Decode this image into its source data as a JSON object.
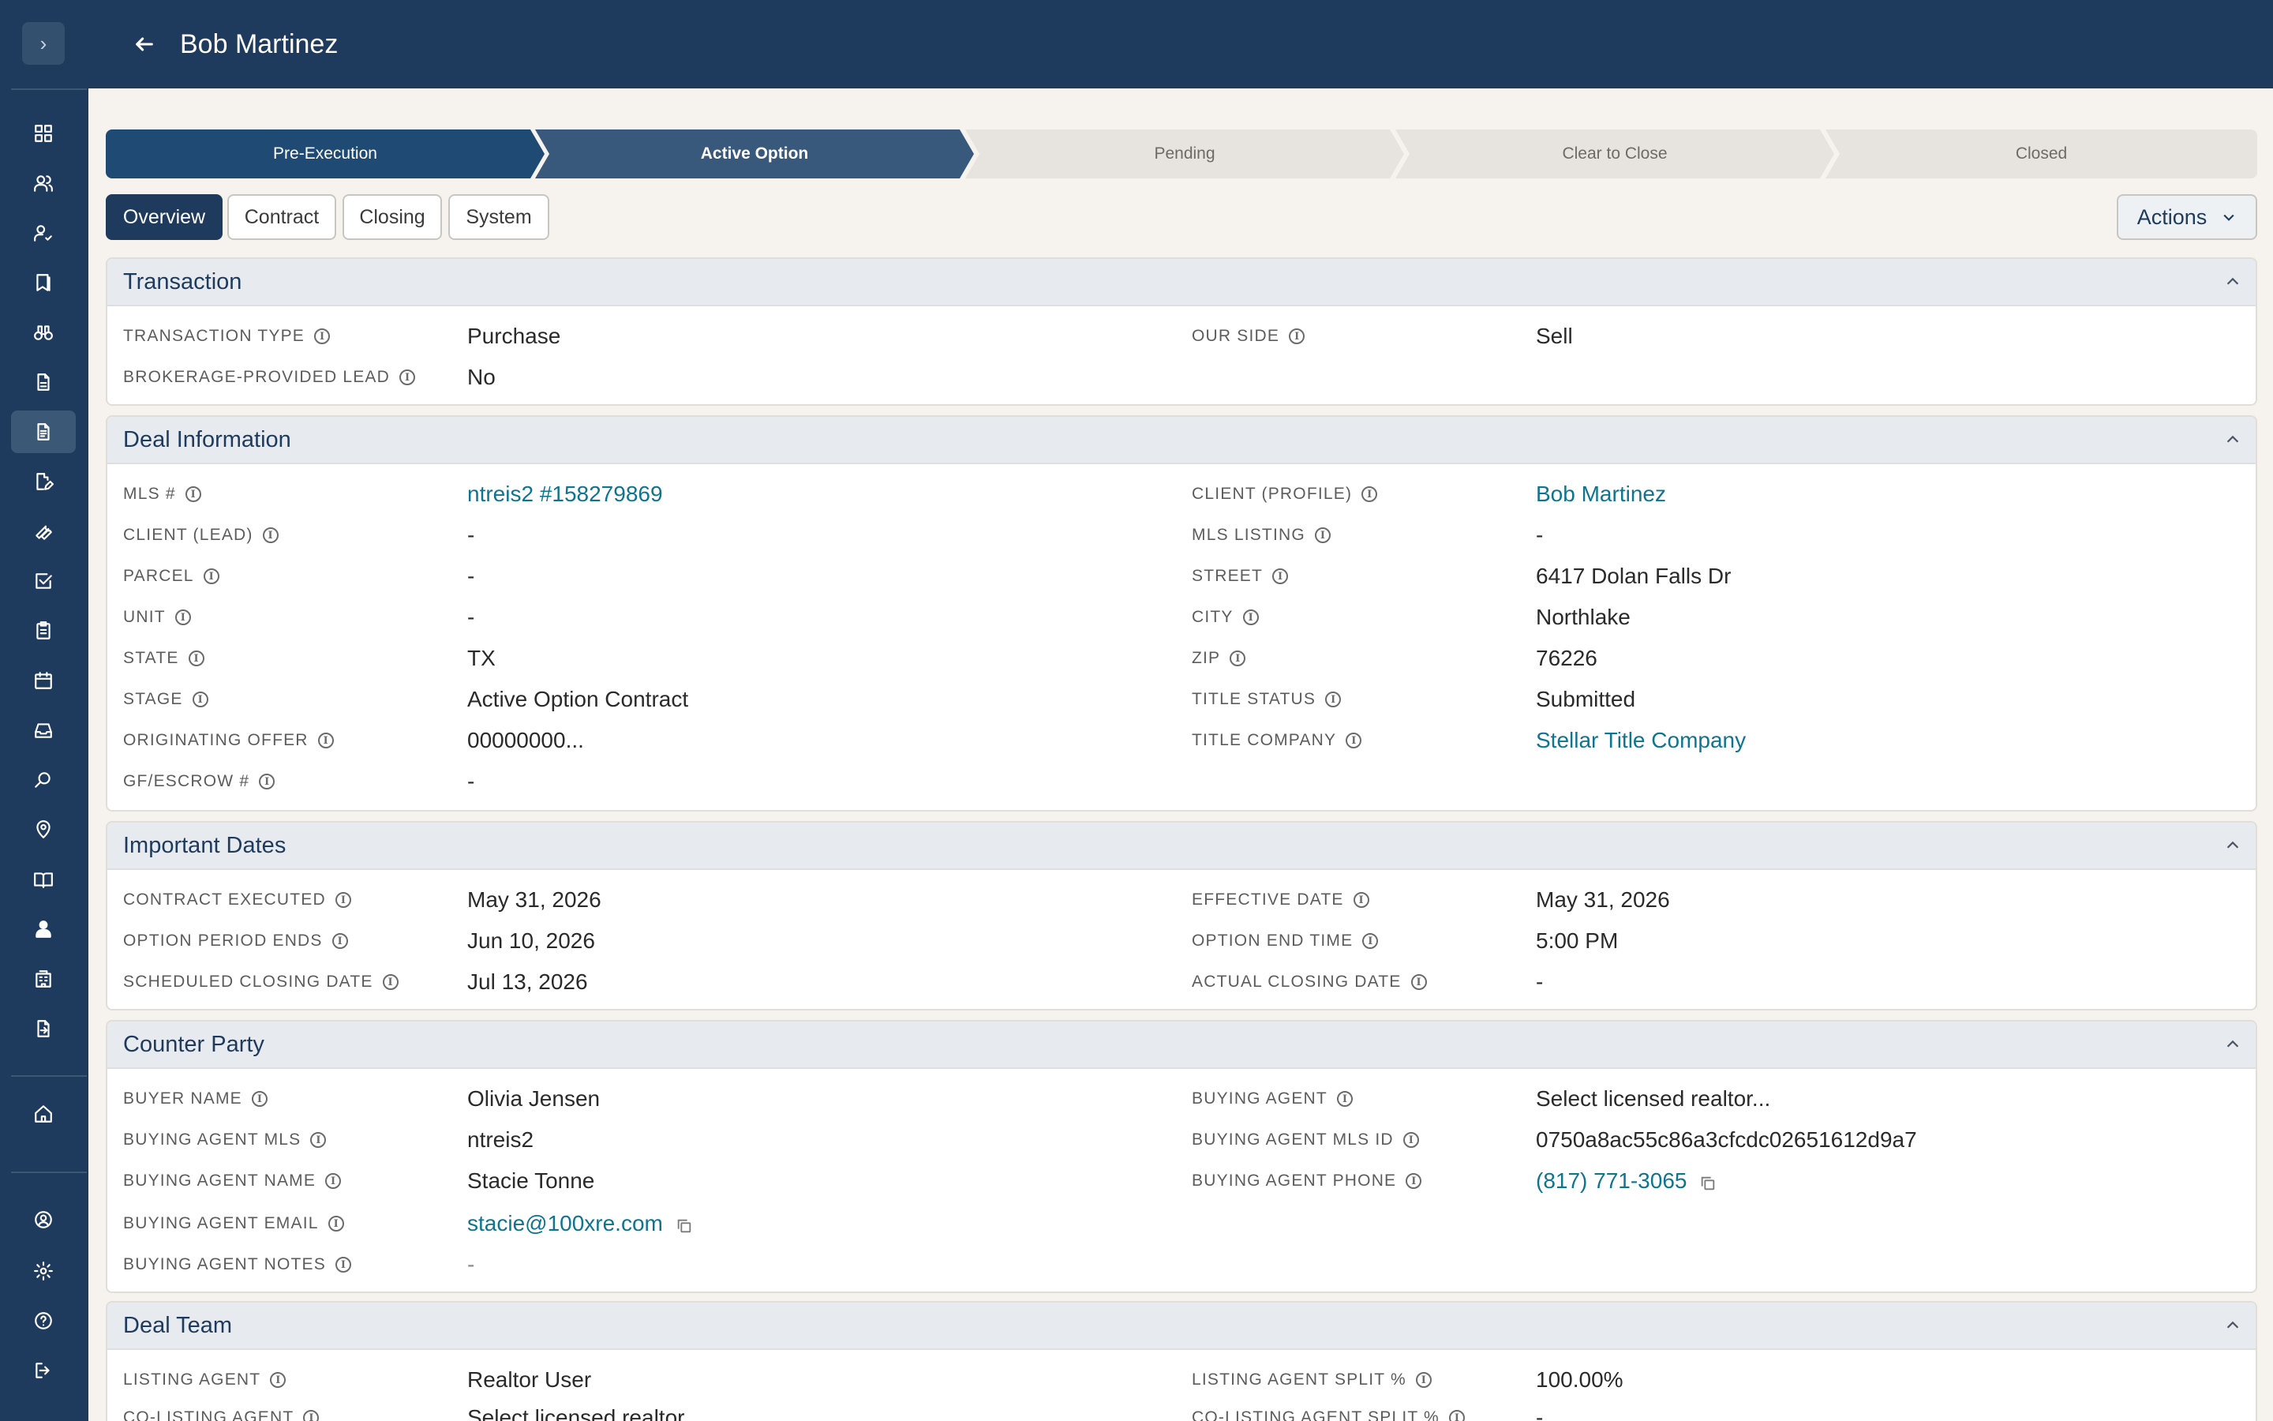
{
  "header": {
    "title": "Bob Martinez"
  },
  "stepper": [
    {
      "label": "Pre-Execution",
      "state": "done"
    },
    {
      "label": "Active Option",
      "state": "current"
    },
    {
      "label": "Pending",
      "state": "todo"
    },
    {
      "label": "Clear to Close",
      "state": "todo"
    },
    {
      "label": "Closed",
      "state": "todo"
    }
  ],
  "tabs": [
    {
      "label": "Overview",
      "active": true
    },
    {
      "label": "Contract",
      "active": false
    },
    {
      "label": "Closing",
      "active": false
    },
    {
      "label": "System",
      "active": false
    }
  ],
  "actions_label": "Actions",
  "sidebar": {
    "items": [
      "dashboard-icon",
      "users-icon",
      "user-check-icon",
      "book-icon",
      "binoculars-icon",
      "file-icon",
      "document-icon",
      "file-edit-icon",
      "wrench-icon",
      "checkbox-icon",
      "clipboard-icon",
      "calendar-icon",
      "inbox-icon",
      "search-icon",
      "map-pin-icon",
      "book-open-icon",
      "person-icon",
      "building-icon",
      "file-export-icon",
      "home-icon",
      "user-circle-icon",
      "gear-icon",
      "help-icon",
      "logout-icon"
    ],
    "active": "document-icon"
  },
  "sections": {
    "transaction": {
      "title": "Transaction",
      "rows": [
        [
          {
            "label": "TRANSACTION TYPE",
            "value": "Purchase"
          },
          {
            "label": "OUR SIDE",
            "value": "Sell"
          }
        ],
        [
          {
            "label": "BROKERAGE-PROVIDED LEAD",
            "value": "No"
          }
        ]
      ]
    },
    "deal": {
      "title": "Deal Information",
      "rows": [
        [
          {
            "label": "MLS #",
            "value": "ntreis2 #158279869"
          },
          {
            "label": "CLIENT (PROFILE)",
            "value": "Bob Martinez"
          }
        ],
        [
          {
            "label": "CLIENT (LEAD)",
            "value": "-"
          },
          {
            "label": "MLS LISTING",
            "value": "-"
          }
        ],
        [
          {
            "label": "PARCEL",
            "value": "-"
          },
          {
            "label": "STREET",
            "value": "6417 Dolan Falls Dr"
          }
        ],
        [
          {
            "label": "UNIT",
            "value": "-"
          },
          {
            "label": "CITY",
            "value": "Northlake"
          }
        ],
        [
          {
            "label": "STATE",
            "value": "TX"
          },
          {
            "label": "ZIP",
            "value": "76226"
          }
        ],
        [
          {
            "label": "STAGE",
            "value": "Active Option Contract"
          },
          {
            "label": "TITLE STATUS",
            "value": "Submitted"
          }
        ],
        [
          {
            "label": "ORIGINATING OFFER",
            "value": "00000000..."
          },
          {
            "label": "TITLE COMPANY",
            "value": "Stellar Title Company"
          }
        ],
        [
          {
            "label": "GF/ESCROW #",
            "value": "-"
          }
        ]
      ]
    },
    "dates": {
      "title": "Important Dates",
      "rows": [
        [
          {
            "label": "CONTRACT EXECUTED",
            "value": "May 31, 2026"
          },
          {
            "label": "EFFECTIVE DATE",
            "value": "May 31, 2026"
          }
        ],
        [
          {
            "label": "OPTION PERIOD ENDS",
            "value": "Jun 10, 2026"
          },
          {
            "label": "OPTION END TIME",
            "value": "5:00 PM"
          }
        ],
        [
          {
            "label": "SCHEDULED CLOSING DATE",
            "value": "Jul 13, 2026"
          },
          {
            "label": "ACTUAL CLOSING DATE",
            "value": "-"
          }
        ]
      ]
    },
    "counter": {
      "title": "Counter Party",
      "rows": [
        [
          {
            "label": "BUYER NAME",
            "value": "Olivia Jensen"
          },
          {
            "label": "BUYING AGENT",
            "value": "Select licensed realtor..."
          }
        ],
        [
          {
            "label": "BUYING AGENT MLS",
            "value": "ntreis2"
          },
          {
            "label": "BUYING AGENT MLS ID",
            "value": "0750a8ac55c86a3cfcdc02651612d9a7"
          }
        ],
        [
          {
            "label": "BUYING AGENT NAME",
            "value": "Stacie Tonne"
          },
          {
            "label": "BUYING AGENT PHONE",
            "value": "(817) 771-3065"
          }
        ],
        [
          {
            "label": "BUYING AGENT EMAIL",
            "value": "stacie@100xre.com"
          }
        ],
        [
          {
            "label": "BUYING AGENT NOTES",
            "value": "-"
          }
        ]
      ]
    },
    "team": {
      "title": "Deal Team",
      "rows": [
        [
          {
            "label": "LISTING AGENT",
            "value": "Realtor User"
          },
          {
            "label": "LISTING AGENT SPLIT %",
            "value": "100.00%"
          }
        ],
        [
          {
            "label": "CO-LISTING AGENT",
            "value": "Select licensed realtor..."
          },
          {
            "label": "CO-LISTING AGENT SPLIT %",
            "value": "-"
          }
        ]
      ]
    }
  },
  "colors": {
    "navy": "#1e3a5c",
    "link": "#0e7490",
    "background": "#f6f3ee"
  }
}
